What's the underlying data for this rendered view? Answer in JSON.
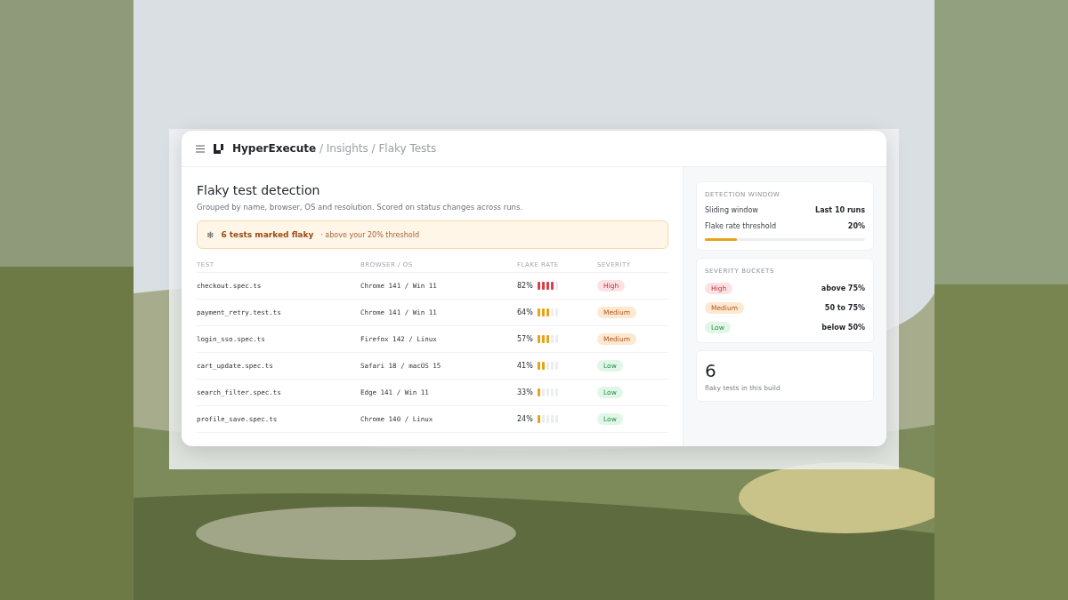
{
  "header": {
    "brand": "HyperExecute",
    "crumbs": [
      " / Insights",
      " / Flaky Tests"
    ]
  },
  "main": {
    "title": "Flaky test detection",
    "subtitle": "Grouped by name, browser, OS and resolution. Scored on status changes across runs.",
    "alert": {
      "icon": "❄",
      "title": "6 tests marked flaky",
      "note": "· above your 20% threshold"
    },
    "table": {
      "columns": [
        "TEST",
        "BROWSER / OS",
        "FLAKE RATE",
        "SEVERITY"
      ],
      "rows": [
        {
          "test": "checkout.spec.ts",
          "env": "Chrome 141 / Win 11",
          "rate": "82%",
          "level": 0.8,
          "severity": "High",
          "kind": "high"
        },
        {
          "test": "payment_retry.test.ts",
          "env": "Chrome 141 / Win 11",
          "rate": "64%",
          "level": 0.6,
          "severity": "Medium",
          "kind": "medium"
        },
        {
          "test": "login_sso.spec.ts",
          "env": "Firefox 142 / Linux",
          "rate": "57%",
          "level": 0.6,
          "severity": "Medium",
          "kind": "medium"
        },
        {
          "test": "cart_update.spec.ts",
          "env": "Safari 18 / macOS 15",
          "rate": "41%",
          "level": 0.4,
          "severity": "Low",
          "kind": "low"
        },
        {
          "test": "search_filter.spec.ts",
          "env": "Edge 141 / Win 11",
          "rate": "33%",
          "level": 0.2,
          "severity": "Low",
          "kind": "low"
        },
        {
          "test": "profile_save.spec.ts",
          "env": "Chrome 140 / Linux",
          "rate": "24%",
          "level": 0.2,
          "severity": "Low",
          "kind": "low"
        }
      ]
    }
  },
  "side": {
    "window": {
      "heading": "DETECTION WINDOW",
      "rows": [
        {
          "label": "Sliding window",
          "value": "Last 10 runs"
        },
        {
          "label": "Flake rate threshold",
          "value": "20%"
        }
      ],
      "level": 0.2
    },
    "buckets": {
      "heading": "SEVERITY BUCKETS",
      "rows": [
        {
          "label": "High",
          "kind": "high",
          "value": "above 75%"
        },
        {
          "label": "Medium",
          "kind": "medium",
          "value": "50 to 75%"
        },
        {
          "label": "Low",
          "kind": "low",
          "value": "below 50%"
        }
      ]
    },
    "stat": {
      "value": "6",
      "label": "flaky tests in this build"
    }
  }
}
